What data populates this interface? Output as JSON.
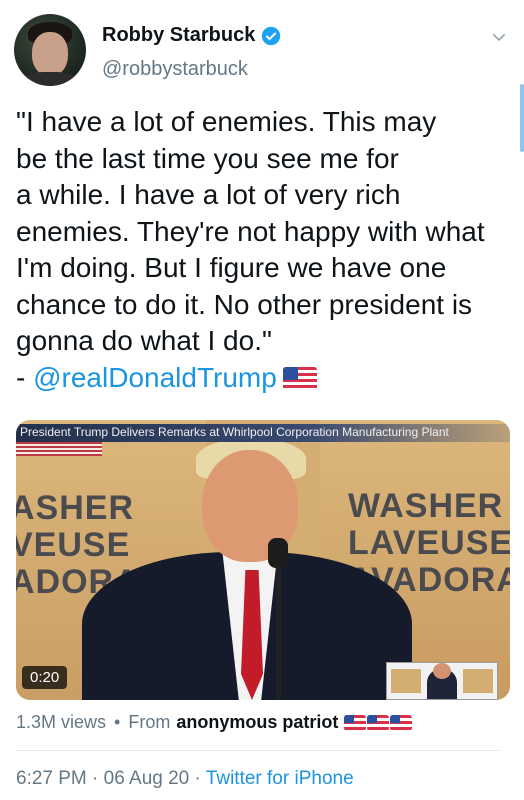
{
  "author": {
    "name": "Robby Starbuck",
    "handle": "@robbystarbuck",
    "verified": true,
    "icons": {
      "verified": "verified-badge-icon",
      "menu": "chevron-down-icon"
    }
  },
  "tweet": {
    "text_lines": [
      "\"I have a lot of enemies. This may",
      "be the last time you see me for",
      "a while. I have a lot of very rich",
      "enemies. They're not happy with what",
      "I'm doing. But I figure we have one",
      "chance to do it. No other president is",
      "gonna do what I do.\""
    ],
    "attribution_prefix": "- ",
    "mention": "@realDonaldTrump"
  },
  "media": {
    "type": "video",
    "caption_bar": "President Trump Delivers Remarks at Whirlpool Corporation Manufacturing Plant",
    "sign_left": [
      "ASHER",
      "VEUSE",
      "ADORA"
    ],
    "sign_right": [
      "WASHER",
      "LAVEUSE",
      "AVADORA"
    ],
    "duration": "0:20"
  },
  "stats": {
    "views": "1.3M views",
    "separator": "•",
    "from_label": "From",
    "uploader": "anonymous patriot"
  },
  "meta": {
    "time": "6:27 PM",
    "date": "06 Aug 20",
    "separator": "·",
    "source": "Twitter for iPhone"
  },
  "colors": {
    "text": "#0f1419",
    "secondary": "#657786",
    "link": "#1b95e0",
    "verified": "#1da1f2"
  }
}
